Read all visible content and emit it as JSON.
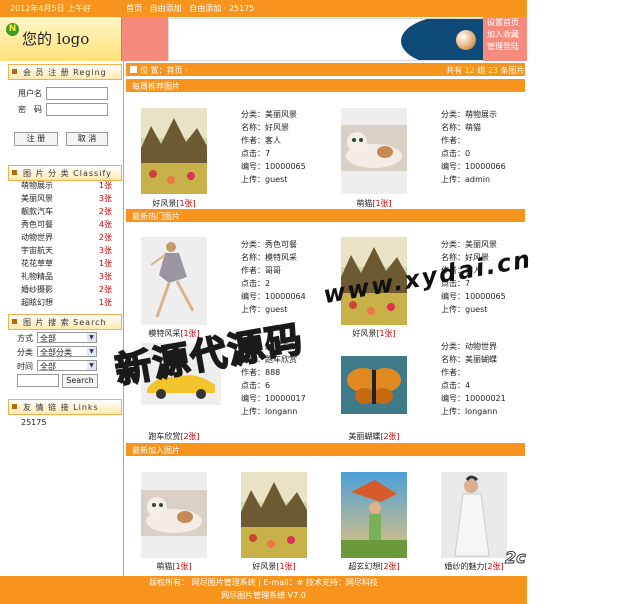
{
  "topbar": {
    "date": "2012年4月5日 上午好",
    "crumb": "首页 · 自由添加 · 自由添加 · 25175"
  },
  "header": {
    "logo_text": "您的 logo",
    "logo_mark": "N",
    "links": [
      "设置首页",
      "加入收藏",
      "管理登陆"
    ]
  },
  "login": {
    "title": "会 员 注 册 Reging",
    "user_label": "用户名",
    "pwd_label": "密　码",
    "login_btn": "注 册",
    "cancel_btn": "取 消"
  },
  "classify": {
    "title": "图 片 分 类 Classify",
    "items": [
      {
        "name": "萌物展示",
        "count": "1张"
      },
      {
        "name": "美丽风景",
        "count": "3张"
      },
      {
        "name": "靓款汽车",
        "count": "2张"
      },
      {
        "name": "秀色可餐",
        "count": "4张"
      },
      {
        "name": "动物世界",
        "count": "2张"
      },
      {
        "name": "宇宙航天",
        "count": "3张"
      },
      {
        "name": "花花草草",
        "count": "1张"
      },
      {
        "name": "礼物精品",
        "count": "3张"
      },
      {
        "name": "婚纱摄影",
        "count": "2张"
      },
      {
        "name": "超眩幻想",
        "count": "1张"
      }
    ]
  },
  "search": {
    "title": "图 片 搜 索 Search",
    "mode_label": "方式",
    "mode_value": "全部",
    "cat_label": "分类",
    "cat_value": "全部分类",
    "time_label": "时间",
    "time_value": "全部",
    "button": "Search"
  },
  "links": {
    "title": "友 情 链 接 Links",
    "item": "25175"
  },
  "location": {
    "text": "位 置：首页 ·",
    "total_prefix": "共有",
    "groups": "12",
    "group_unit": "组",
    "photos": "23",
    "photo_unit": "条图片"
  },
  "sections": [
    {
      "title": "每周推荐图片",
      "items": [
        {
          "caption": "好风景",
          "count": "[1张]",
          "info": [
            "分类：美丽风景",
            "名称：好风景",
            "作者：客人",
            "点击：7",
            "编号：10000065",
            "上传：guest"
          ]
        },
        {
          "caption": "萌猫",
          "count": "[1张]",
          "info": [
            "分类：萌物展示",
            "名称：萌猫",
            "作者：",
            "点击：0",
            "编号：10000066",
            "上传：admin"
          ]
        }
      ]
    },
    {
      "title": "最新热门图片",
      "items": [
        {
          "caption": "模特风采",
          "count": "[1张]",
          "info": [
            "分类：秀色可餐",
            "名称：模特风采",
            "作者：哥哥",
            "点击：2",
            "编号：10000064",
            "上传：guest"
          ]
        },
        {
          "caption": "好风景",
          "count": "[1张]",
          "info": [
            "分类：美丽风景",
            "名称：好风景",
            "作者：客人",
            "点击：7",
            "编号：10000065",
            "上传：guest"
          ]
        },
        {
          "caption": "跑车欣赏",
          "count": "[2张]",
          "info": [
            "分类：靓款汽车",
            "名称：跑车欣赏",
            "作者：888",
            "点击：6",
            "编号：10000017",
            "上传：longann"
          ]
        },
        {
          "caption": "美丽蝴蝶",
          "count": "[2张]",
          "info": [
            "分类：动物世界",
            "名称：美丽蝴蝶",
            "作者：",
            "点击：4",
            "编号：10000021",
            "上传：longann"
          ]
        }
      ]
    },
    {
      "title": "最新加入图片",
      "items": [
        {
          "caption": "萌猫",
          "count": "[1张]"
        },
        {
          "caption": "好风景",
          "count": "[1张]"
        },
        {
          "caption": "超玄幻想",
          "count": "[2张]"
        },
        {
          "caption": "婚纱的魅力",
          "count": "[2张]"
        }
      ]
    }
  ],
  "footer": {
    "line1": "版权所有： 网尽图片管理系统 | E-mail：# 技术支持：网尽科技",
    "line2": "网尽图片管理系统 V7.0"
  },
  "watermark": {
    "url": "www.xydai.cn",
    "brand": "新源代源码",
    "corner": "2c"
  }
}
